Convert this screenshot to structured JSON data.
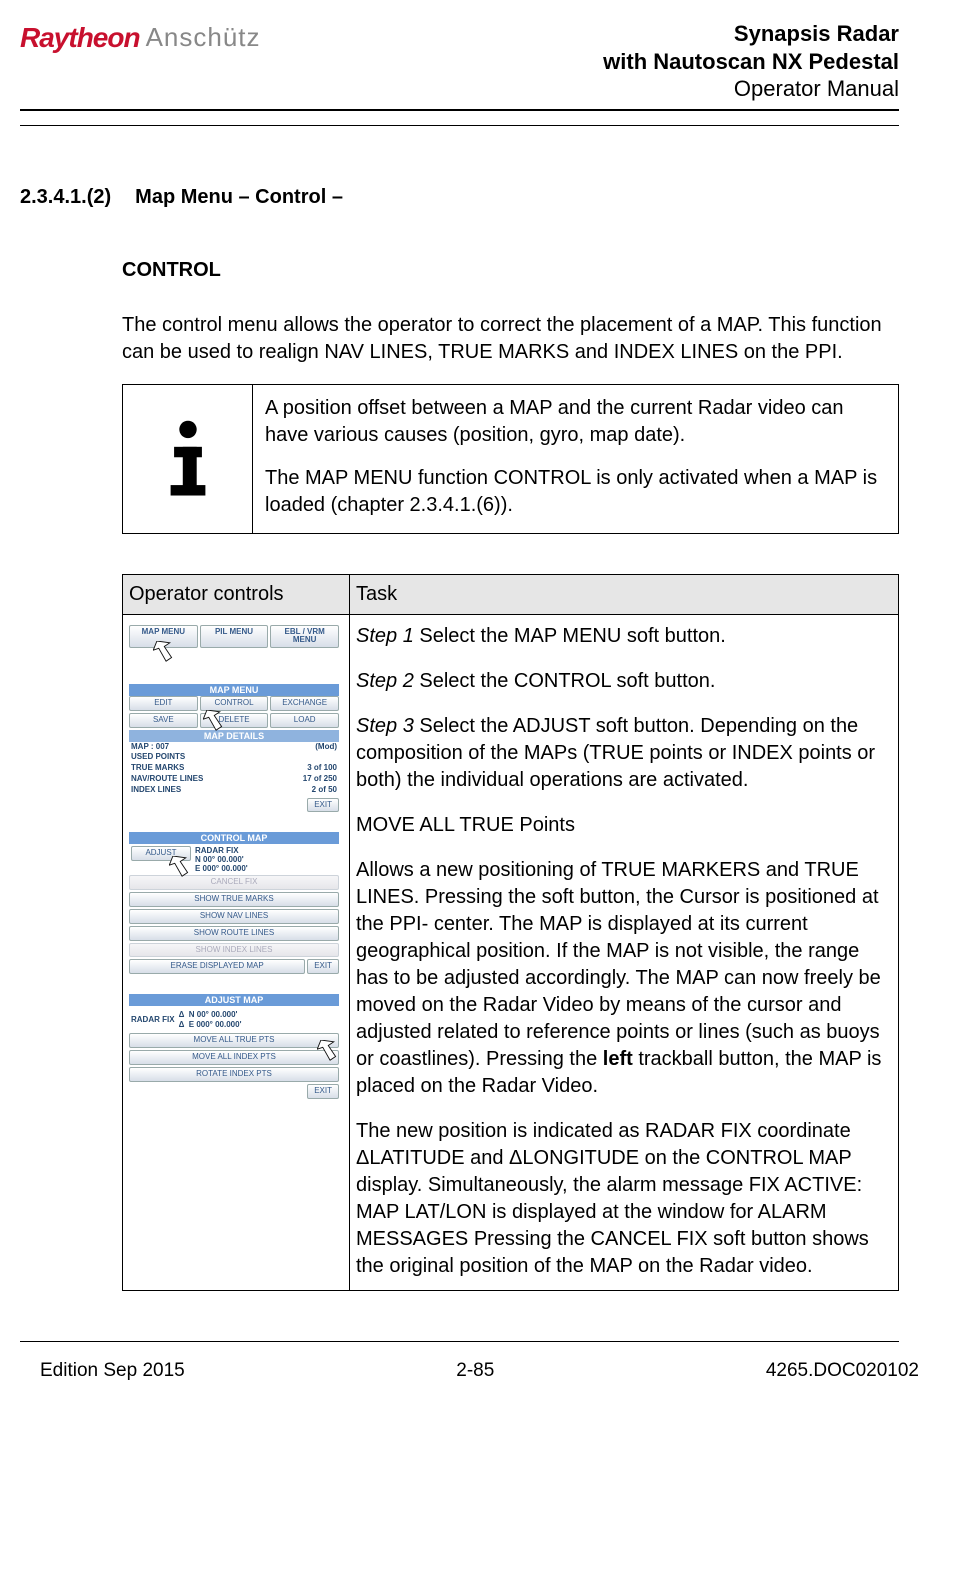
{
  "header": {
    "logo_left": "Raytheon",
    "logo_right": "Anschütz",
    "title_line1": "Synapsis Radar",
    "title_line2": "with Nautoscan NX Pedestal",
    "title_line3": "Operator Manual"
  },
  "section": {
    "number": "2.3.4.1.(2)",
    "title": "Map Menu – Control –"
  },
  "control_heading": "CONTROL",
  "intro": "The control menu allows the operator to correct the placement of a MAP. This function can be used to realign NAV LINES, TRUE MARKS and INDEX LINES on the PPI.",
  "info": {
    "p1": "A position offset between a MAP and the current Radar video can have various causes (position, gyro, map date).",
    "p2": "The MAP MENU function CONTROL is only activated when a MAP is loaded (chapter 2.3.4.1.(6))."
  },
  "table": {
    "head_col1": "Operator controls",
    "head_col2": "Task",
    "task": {
      "step1_label": "Step 1",
      "step1_text": " Select the MAP MENU soft button.",
      "step2_label": "Step 2",
      "step2_text": " Select the CONTROL soft button.",
      "step3_label": "Step 3",
      "step3_text": " Select the ADJUST soft button. Depending on the composition of the MAPs (TRUE points or INDEX points or both) the individual operations are activated.",
      "move_true_heading": "MOVE ALL TRUE Points",
      "move_true_p1": "Allows a new positioning of TRUE MARKERS and TRUE LINES. Pressing the soft button, the Cursor is positioned at the PPI- center. The MAP is displayed at its current geographical position. If the MAP is not visible, the range has to be adjusted accordingly. The MAP can now freely be moved on the Radar Video by means of the cursor and adjusted related to reference points or lines (such as buoys or coastlines). Pressing the ",
      "left_bold": "left",
      "move_true_p1_cont": " trackball button, the MAP is placed on the Radar Video.",
      "move_true_p2": "The new position is indicated as RADAR FIX coordinate ΔLATITUDE and ΔLONGITUDE on the CONTROL MAP display. Simultaneously, the alarm message FIX ACTIVE: MAP LAT/LON is displayed at the window for ALARM MESSAGES Pressing the CANCEL FIX soft button shows the original position of the MAP on the Radar video."
    }
  },
  "mini_ui": {
    "top_menu": [
      "MAP MENU",
      "PIL MENU",
      "EBL / VRM MENU"
    ],
    "map_menu": {
      "title": "MAP MENU",
      "row1": [
        "EDIT",
        "CONTROL",
        "EXCHANGE"
      ],
      "row2": [
        "SAVE",
        "DELETE",
        "LOAD"
      ],
      "details_title": "MAP DETAILS",
      "details": [
        {
          "label": "MAP : 007",
          "right": "(Mod)"
        },
        {
          "label": "USED POINTS",
          "right": ""
        },
        {
          "label": "TRUE MARKS",
          "right": "3  of   100"
        },
        {
          "label": "NAV/ROUTE LINES",
          "right": "17  of   250"
        },
        {
          "label": "INDEX LINES",
          "right": "2  of    50"
        }
      ],
      "exit": "EXIT"
    },
    "control_map": {
      "title": "CONTROL MAP",
      "adjust": "ADJUST",
      "radar_fix_label": "RADAR FIX",
      "radar_fix_lines": [
        "N 00° 00.000'",
        "E 000° 00.000'"
      ],
      "cancel": "CANCEL FIX",
      "buttons": [
        "SHOW TRUE MARKS",
        "SHOW NAV LINES",
        "SHOW ROUTE LINES",
        "SHOW INDEX LINES"
      ],
      "erase": "ERASE DISPLAYED MAP",
      "exit": "EXIT"
    },
    "adjust_map": {
      "title": "ADJUST MAP",
      "radar_fix_label": "RADAR FIX",
      "delta": "Δ",
      "lines": [
        "N 00° 00.000'",
        "E 000° 00.000'"
      ],
      "buttons": [
        "MOVE ALL TRUE PTS",
        "MOVE ALL INDEX PTS",
        "ROTATE INDEX PTS"
      ],
      "exit": "EXIT"
    }
  },
  "footer": {
    "left": "Edition Sep 2015",
    "center": "2-85",
    "right": "4265.DOC020102"
  }
}
